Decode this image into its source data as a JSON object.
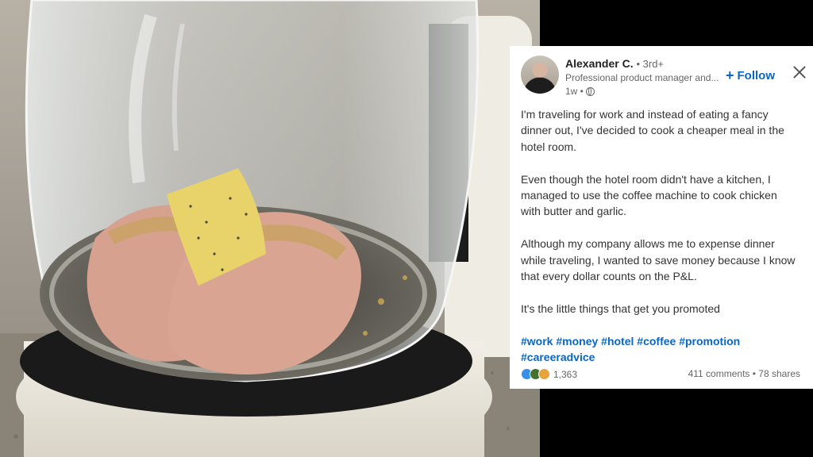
{
  "post": {
    "author": "Alexander C.",
    "degree": "• 3rd+",
    "headline": "Professional product manager and...",
    "time": "1w •",
    "follow_label": "Follow",
    "follow_icon": "+",
    "paragraphs": [
      "I'm traveling for work and instead of eating a fancy dinner out, I've decided to cook a cheaper meal in the hotel room.",
      "Even though the hotel room didn't have a kitchen, I managed to use the coffee machine to cook chicken with butter and garlic.",
      "Although my company allows me to expense dinner while traveling, I wanted to save money because I know that every dollar counts on the P&L.",
      "It's the little things that get you promoted"
    ],
    "hashtags": [
      "#work",
      "#money",
      "#hotel",
      "#coffee",
      "#promotion",
      "#careeradvice"
    ],
    "reaction_count": "1,363",
    "comments": "411 comments",
    "separator": "•",
    "shares": "78 shares"
  },
  "colors": {
    "link": "#0a66c2",
    "card_bg": "#ffffff",
    "backdrop": "#000000"
  }
}
